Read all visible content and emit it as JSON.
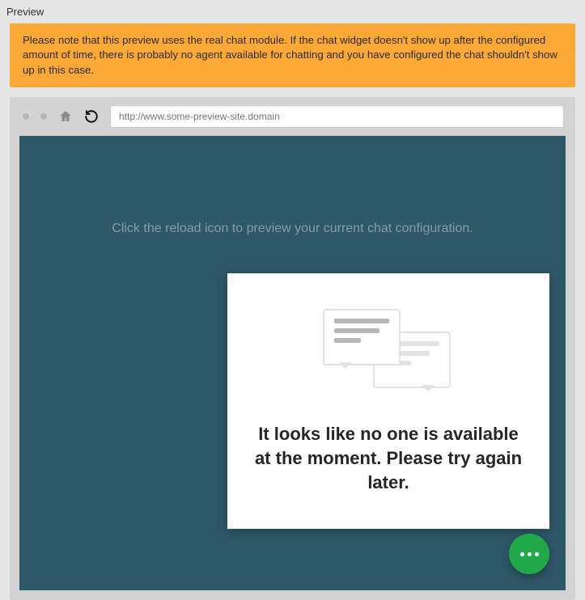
{
  "title": "Preview",
  "alert_text": "Please note that this preview uses the real chat module. If the chat widget doesn't show up after the configured amount of time, there is probably no agent available for chatting and you have configured the chat shouldn't show up in this case.",
  "address_placeholder": "http://www.some-preview-site.domain",
  "address_value": "",
  "hint_text": "Click the reload icon to preview your current chat configuration.",
  "chat_widget": {
    "message": "It looks like no one is available at the moment. Please try again later."
  },
  "icons": {
    "home": "home-icon",
    "reload": "reload-icon",
    "fab": "more-horizontal-icon"
  },
  "colors": {
    "alert_bg": "#faa937",
    "viewport_bg": "#2e5768",
    "fab_bg": "#20a849"
  }
}
